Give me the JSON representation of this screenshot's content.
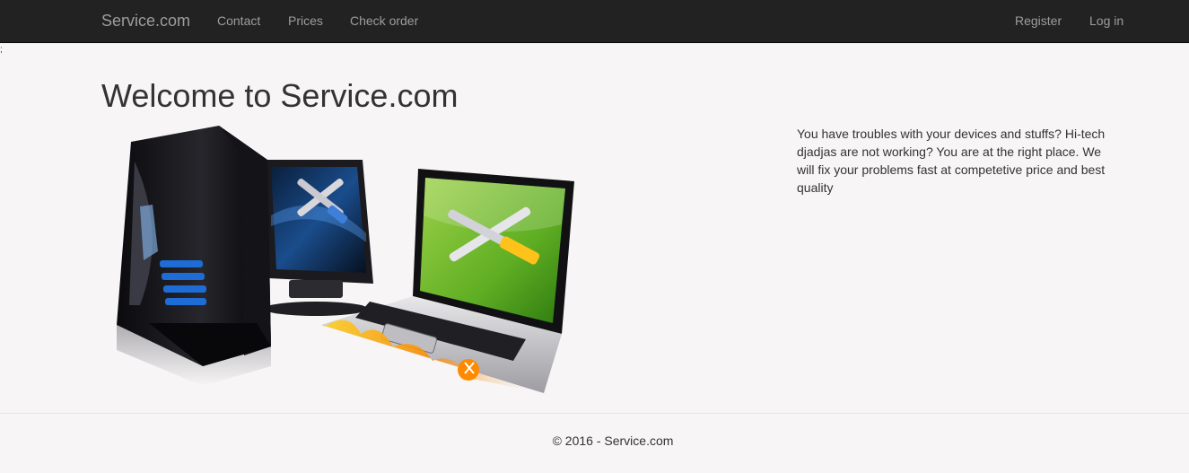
{
  "navbar": {
    "brand": "Service.com",
    "left_links": [
      "Contact",
      "Prices",
      "Check order"
    ],
    "right_links": [
      "Register",
      "Log in"
    ]
  },
  "stray_text": ";",
  "main": {
    "title": "Welcome to Service.com",
    "description": "You have troubles with your devices and stuffs? Hi-tech djadjas are not working? You are at the right place. We will fix your problems fast at competetive price and best quality",
    "image_subject": "computer-repair-illustration"
  },
  "footer": {
    "text": "© 2016 - Service.com"
  },
  "colors": {
    "navbar_bg": "#222222",
    "navbar_text": "#9d9d9d",
    "page_bg": "#f7f5f6",
    "text": "#333333"
  }
}
